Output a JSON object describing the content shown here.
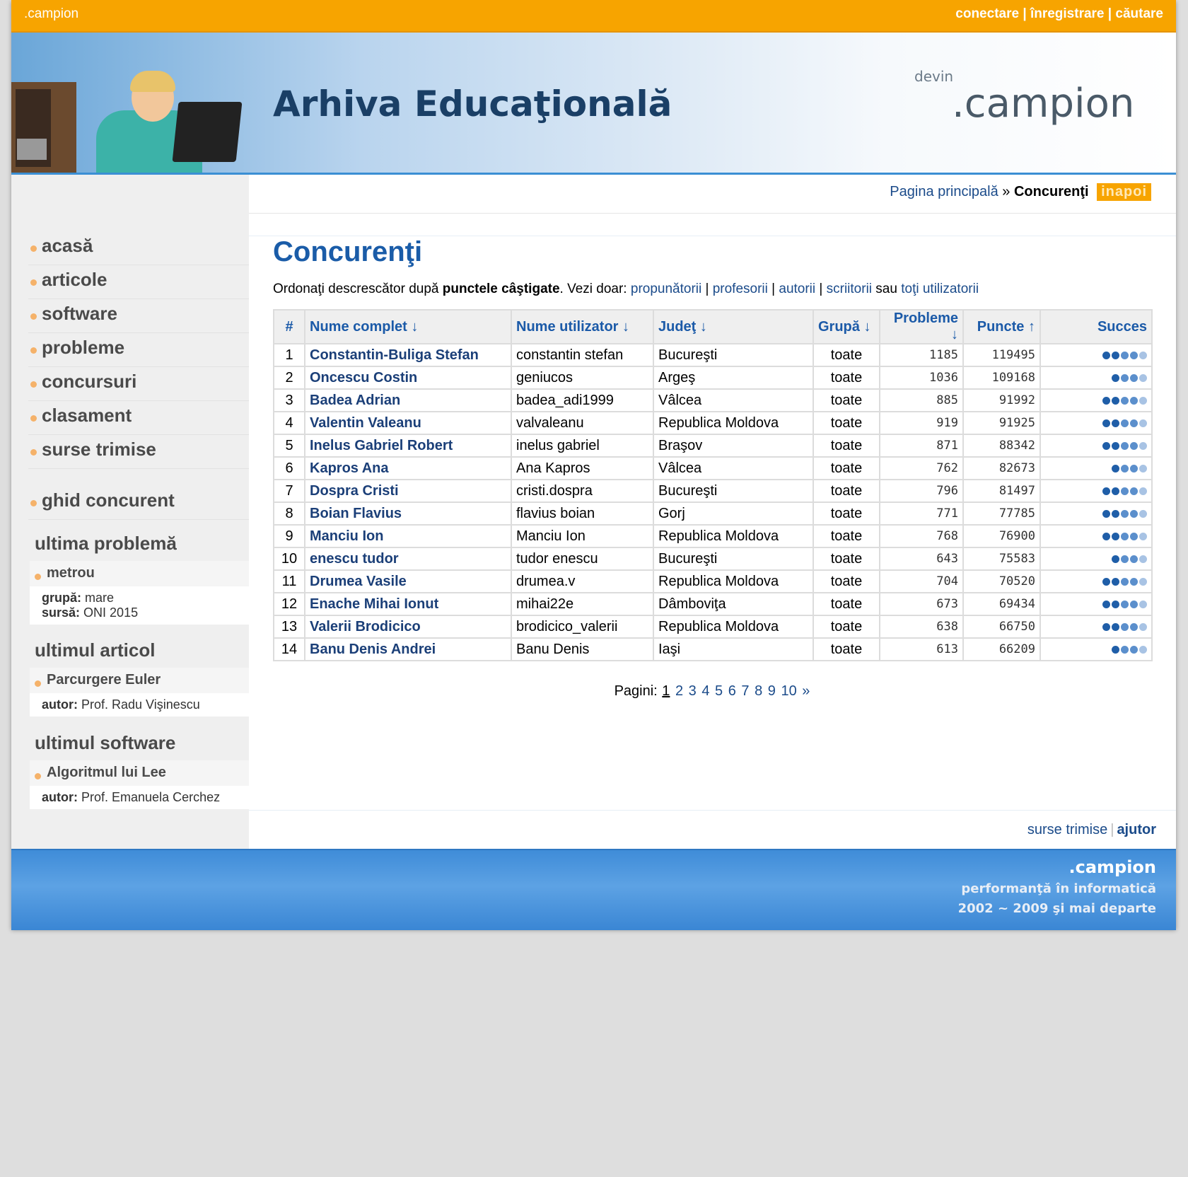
{
  "topbar": {
    "brand": ".campion",
    "links": [
      "conectare",
      "înregistrare",
      "căutare"
    ],
    "separator": "|"
  },
  "banner": {
    "title": "Arhiva Educaţională",
    "devin": "devin",
    "logo": ".campion"
  },
  "breadcrumb": {
    "home": "Pagina principală",
    "separator": "»",
    "current": "Concurenţi",
    "back": "inapoi"
  },
  "sidebar": {
    "menu": [
      "acasă",
      "articole",
      "software",
      "probleme",
      "concursuri",
      "clasament",
      "surse trimise"
    ],
    "guide": "ghid concurent",
    "last_problem": {
      "heading": "ultima problemă",
      "title": "metrou",
      "group_label": "grupă:",
      "group": "mare",
      "source_label": "sursă:",
      "source": "ONI 2015"
    },
    "last_article": {
      "heading": "ultimul articol",
      "title": "Parcurgere Euler",
      "author_label": "autor:",
      "author": "Prof. Radu Vişinescu"
    },
    "last_software": {
      "heading": "ultimul software",
      "title": "Algoritmul lui Lee",
      "author_label": "autor:",
      "author": "Prof. Emanuela Cerchez"
    }
  },
  "main": {
    "title": "Concurenţi",
    "intro": {
      "pre": "Ordonaţi descrescător după ",
      "bold": "punctele câştigate",
      "mid": ". Vezi doar: ",
      "links": [
        "propunătorii",
        "profesorii",
        "autorii",
        "scriitorii"
      ],
      "sep": " | ",
      "or": " sau ",
      "all": "toţi utilizatorii"
    },
    "columns": [
      "#",
      "Nume complet ↓",
      "Nume utilizator ↓",
      "Judeţ ↓",
      "Grupă ↓",
      "Probleme ↓",
      "Puncte ↑",
      "Succes"
    ],
    "rows": [
      {
        "n": "1",
        "name": "Constantin-Buliga Stefan",
        "user": "constantin stefan",
        "county": "Bucureşti",
        "group": "toate",
        "problems": "1185",
        "points": "119495",
        "success": 5
      },
      {
        "n": "2",
        "name": "Oncescu Costin",
        "user": "geniucos",
        "county": "Argeş",
        "group": "toate",
        "problems": "1036",
        "points": "109168",
        "success": 4
      },
      {
        "n": "3",
        "name": "Badea Adrian",
        "user": "badea_adi1999",
        "county": "Vâlcea",
        "group": "toate",
        "problems": "885",
        "points": "91992",
        "success": 5
      },
      {
        "n": "4",
        "name": "Valentin Valeanu",
        "user": "valvaleanu",
        "county": "Republica Moldova",
        "group": "toate",
        "problems": "919",
        "points": "91925",
        "success": 5
      },
      {
        "n": "5",
        "name": "Inelus Gabriel Robert",
        "user": "inelus gabriel",
        "county": "Braşov",
        "group": "toate",
        "problems": "871",
        "points": "88342",
        "success": 5
      },
      {
        "n": "6",
        "name": "Kapros Ana",
        "user": "Ana Kapros",
        "county": "Vâlcea",
        "group": "toate",
        "problems": "762",
        "points": "82673",
        "success": 4
      },
      {
        "n": "7",
        "name": "Dospra Cristi",
        "user": "cristi.dospra",
        "county": "Bucureşti",
        "group": "toate",
        "problems": "796",
        "points": "81497",
        "success": 5
      },
      {
        "n": "8",
        "name": "Boian Flavius",
        "user": "flavius boian",
        "county": "Gorj",
        "group": "toate",
        "problems": "771",
        "points": "77785",
        "success": 5
      },
      {
        "n": "9",
        "name": "Manciu Ion",
        "user": "Manciu Ion",
        "county": "Republica Moldova",
        "group": "toate",
        "problems": "768",
        "points": "76900",
        "success": 5
      },
      {
        "n": "10",
        "name": "enescu tudor",
        "user": "tudor enescu",
        "county": "Bucureşti",
        "group": "toate",
        "problems": "643",
        "points": "75583",
        "success": 4
      },
      {
        "n": "11",
        "name": "Drumea Vasile",
        "user": "drumea.v",
        "county": "Republica Moldova",
        "group": "toate",
        "problems": "704",
        "points": "70520",
        "success": 5
      },
      {
        "n": "12",
        "name": "Enache Mihai Ionut",
        "user": "mihai22e",
        "county": "Dâmboviţa",
        "group": "toate",
        "problems": "673",
        "points": "69434",
        "success": 5
      },
      {
        "n": "13",
        "name": "Valerii Brodicico",
        "user": "brodicico_valerii",
        "county": "Republica Moldova",
        "group": "toate",
        "problems": "638",
        "points": "66750",
        "success": 5
      },
      {
        "n": "14",
        "name": "Banu Denis Andrei",
        "user": "Banu Denis",
        "county": "Iaşi",
        "group": "toate",
        "problems": "613",
        "points": "66209",
        "success": 4
      }
    ],
    "pager": {
      "label": "Pagini:",
      "pages": [
        "1",
        "2",
        "3",
        "4",
        "5",
        "6",
        "7",
        "8",
        "9",
        "10"
      ],
      "current": "1",
      "next": "»"
    }
  },
  "footer_links": {
    "sources": "surse trimise",
    "help": "ajutor",
    "sep": "|"
  },
  "footer": {
    "brand": ".campion",
    "tagline": "performanţă în informatică",
    "years": "2002 ~ 2009 şi mai departe"
  },
  "colors": {
    "top_bar": "#f7a400",
    "link": "#1b4b8a",
    "heading": "#1a5ca8",
    "footer": "#3f8cd8"
  }
}
